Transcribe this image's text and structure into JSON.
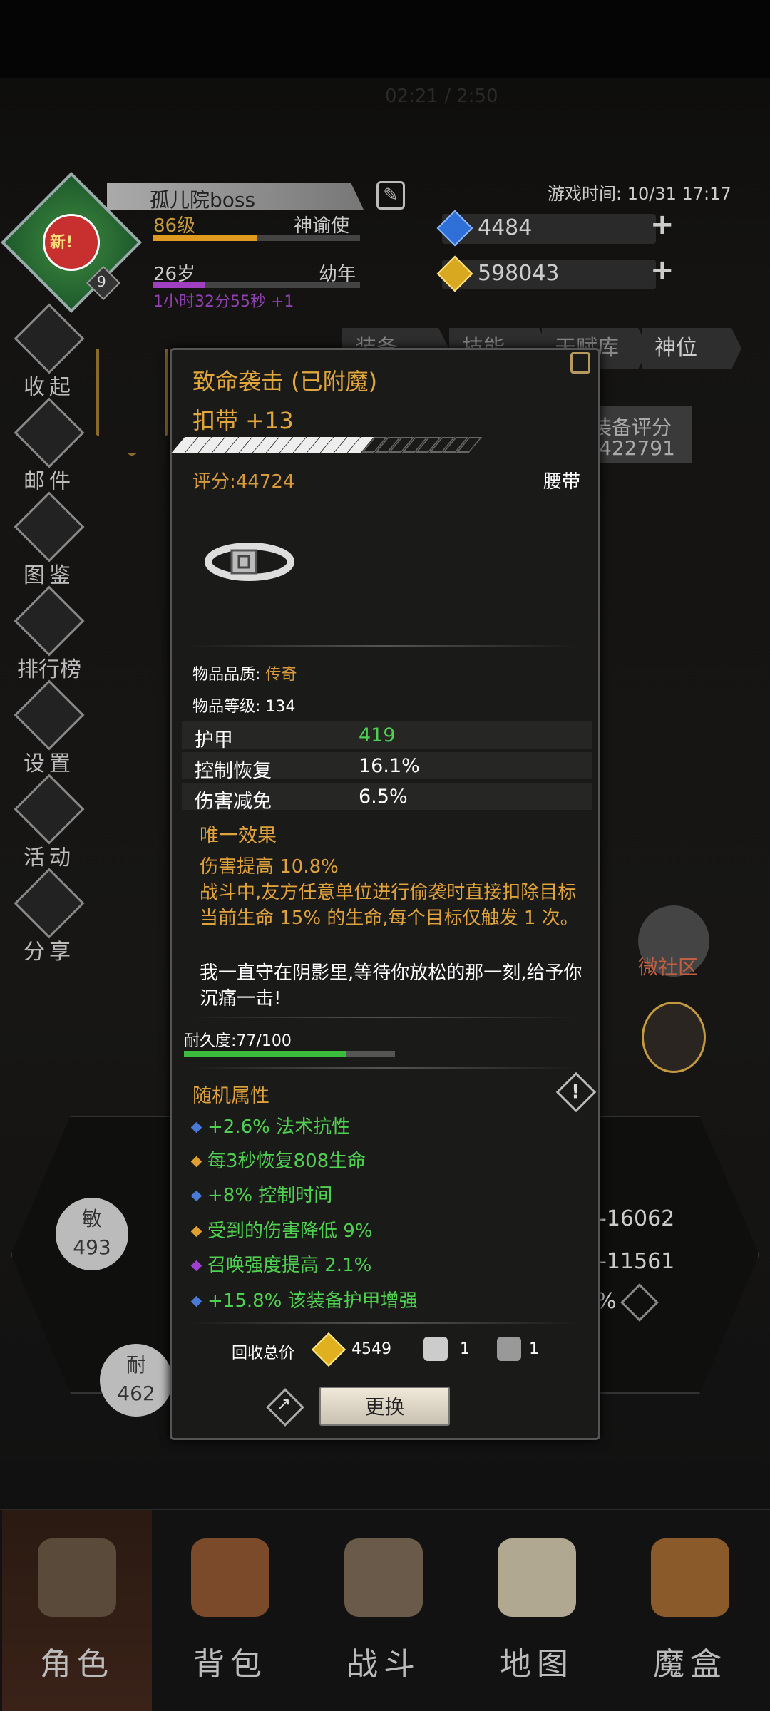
{
  "status_title": "02:21 / 2:50",
  "player": {
    "new_badge": "新!",
    "badge_level": "9",
    "name": "孤儿院boss",
    "level": "86级",
    "title": "神谕使",
    "age": "26岁",
    "stage": "幼年",
    "timer": "1小时32分55秒 +1",
    "level_progress": 0.5,
    "age_progress": 0.25
  },
  "game_time": "游戏时间: 10/31 17:17",
  "currency": {
    "gems": "4484",
    "gold": "598043"
  },
  "side_menu": [
    {
      "label": "收起",
      "icon": "collapse-icon"
    },
    {
      "label": "邮件",
      "icon": "mail-icon"
    },
    {
      "label": "图鉴",
      "icon": "book-icon"
    },
    {
      "label": "排行榜",
      "icon": "ranking-icon"
    },
    {
      "label": "设置",
      "icon": "gear-icon"
    },
    {
      "label": "活动",
      "icon": "event-icon"
    },
    {
      "label": "分享",
      "icon": "share-icon"
    }
  ],
  "tabs": [
    "装备",
    "技能",
    "天赋库",
    "神位"
  ],
  "equip_score": {
    "label": "装备评分",
    "value": "422791"
  },
  "community": "微社区",
  "attributes": {
    "agi_label": "敏",
    "agi_value": "493",
    "end_label": "耐",
    "end_value": "462",
    "right_1": "-16062",
    "right_2": "-11561",
    "right_3": "%"
  },
  "tooltip": {
    "name": "致命袭击 (已附魔)",
    "item": "扣带 +13",
    "score": "评分:44724",
    "slot": "腰带",
    "quality_label": "物品品质:",
    "quality_value": "传奇",
    "item_level": "物品等级: 134",
    "stats": [
      {
        "key": "护甲",
        "value": "419",
        "green": true
      },
      {
        "key": "控制恢复",
        "value": "16.1%",
        "green": false
      },
      {
        "key": "伤害减免",
        "value": "6.5%",
        "green": false
      }
    ],
    "unique_header": "唯一效果",
    "unique_text": "伤害提高 10.8%\n战斗中,友方任意单位进行偷袭时直接扣除目标当前生命 15% 的生命,每个目标仅触发 1 次。",
    "quote": "我一直守在阴影里,等待你放松的那一刻,给予你沉痛一击!",
    "durability_label": "耐久度:77/100",
    "durability": 0.77,
    "random_header": "随机属性",
    "random": [
      {
        "text": "+2.6% 法术抗性",
        "color": "#4a7ad8"
      },
      {
        "text": "每3秒恢复808生命",
        "color": "#e0a030"
      },
      {
        "text": "+8% 控制时间",
        "color": "#4a7ad8"
      },
      {
        "text": "受到的伤害降低 9%",
        "color": "#e0a030"
      },
      {
        "text": "召唤强度提高 2.1%",
        "color": "#a040d0"
      },
      {
        "text": "+15.8% 该装备护甲增强",
        "color": "#4a7ad8"
      }
    ],
    "recycle_label": "回收总价",
    "recycle_gold": "4549",
    "recycle_stone1": "1",
    "recycle_stone2": "1",
    "replace_button": "更换"
  },
  "nav": [
    "角色",
    "背包",
    "战斗",
    "地图",
    "魔盒"
  ]
}
